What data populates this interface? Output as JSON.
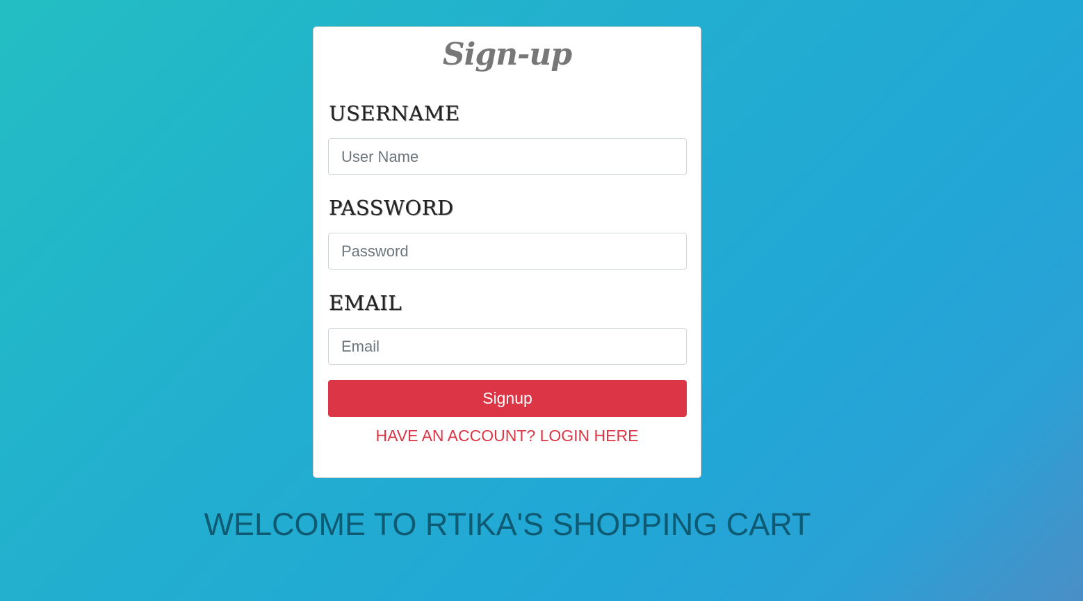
{
  "form": {
    "title": "Sign-up",
    "username_label": "USERNAME",
    "username_placeholder": "User Name",
    "username_value": "",
    "password_label": "PASSWORD",
    "password_placeholder": "Password",
    "password_value": "",
    "email_label": "EMAIL",
    "email_placeholder": "Email",
    "email_value": "",
    "submit_label": "Signup",
    "login_link": "HAVE AN ACCOUNT? LOGIN HERE"
  },
  "welcome_text": "WELCOME TO RTIKA'S SHOPPING CART",
  "colors": {
    "accent": "#dc3545",
    "background_start": "#23bec3",
    "background_end": "#4a8ec6",
    "welcome_text": "#0d5a72"
  }
}
